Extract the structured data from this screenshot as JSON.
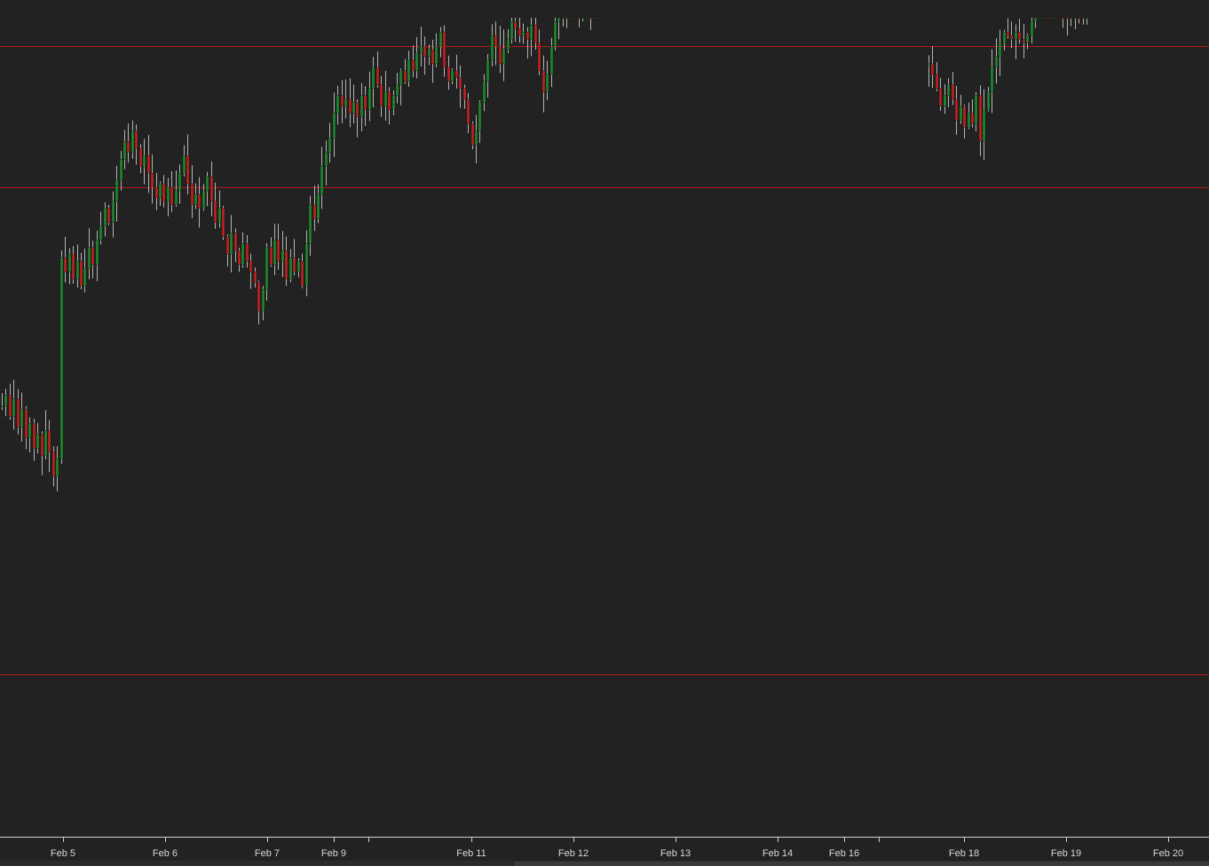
{
  "chart_data": {
    "type": "candlestick",
    "title": "",
    "xlabel": "",
    "ylabel": "",
    "x_tick_labels": [
      "Feb 5",
      "Feb 6",
      "Feb 7",
      "Feb 9",
      "",
      "Feb 11",
      "Feb 12",
      "Feb 13",
      "Feb 14",
      "Feb 16",
      "",
      "Feb 18",
      "Feb 19",
      "Feb 20"
    ],
    "horizontal_levels": [
      92.0,
      88.0,
      74.2
    ],
    "ylim": [
      69.6,
      93.2
    ],
    "grid": false,
    "colors": {
      "up": "#1e8a2e",
      "down": "#c32222",
      "wick": "#b5b5b5",
      "level_line": "#b31b1b",
      "background": "#222222",
      "axis": "#cfcfcf"
    },
    "series": [
      {
        "segment": 1,
        "closes": [
          81.8,
          82.1,
          81.5,
          82.0,
          81.2,
          81.7,
          80.9,
          81.3,
          80.6,
          81.0,
          80.4,
          81.1,
          80.5,
          79.8,
          80.3,
          86.0,
          85.6,
          86.1,
          85.4,
          85.9,
          85.2,
          85.7,
          86.3,
          85.8,
          86.5,
          86.9,
          87.4,
          87.0,
          87.6,
          88.2,
          88.8,
          89.3,
          89.0,
          89.6,
          89.1,
          88.6,
          88.9,
          88.4,
          88.0,
          87.7,
          88.1,
          87.6,
          88.0,
          87.5,
          87.9,
          88.4,
          88.9,
          88.1,
          87.5,
          87.8,
          87.4,
          87.9,
          88.3,
          87.6,
          87.0,
          87.4,
          86.6,
          86.1,
          86.7,
          86.2,
          85.8,
          86.4,
          85.9,
          85.6,
          85.3,
          84.5,
          85.1,
          86.3,
          85.8,
          86.5,
          85.9,
          86.2,
          85.4,
          86.0,
          85.6,
          85.9,
          85.2,
          86.4,
          87.5,
          87.1,
          87.8,
          88.6,
          89.0,
          89.4,
          90.1,
          90.6,
          90.3,
          90.5,
          90.1,
          90.4,
          90.0,
          90.6,
          90.2,
          90.8,
          91.4,
          90.9,
          90.3,
          90.7,
          90.2,
          90.6,
          90.9,
          91.3,
          91.0,
          91.6,
          91.3,
          91.8,
          92.0,
          91.7,
          91.9,
          91.5,
          92.0,
          92.4,
          91.4,
          91.0,
          91.3,
          91.1,
          90.8,
          90.5,
          89.8,
          89.2,
          89.6,
          90.4,
          91.0,
          91.6,
          92.3,
          92.0,
          91.5,
          91.9,
          92.2,
          92.7,
          92.5,
          92.3,
          92.4,
          92.2,
          92.6,
          92.1,
          91.3,
          90.7,
          91.2,
          92.0,
          92.7,
          93.0,
          92.9,
          93.2,
          93.1,
          93.2,
          93.0,
          93.1,
          93.3,
          93.0,
          93.1,
          93.2
        ]
      },
      {
        "segment": 2,
        "closes": [
          91.5,
          91.2,
          90.8,
          90.3,
          90.6,
          90.9,
          90.5,
          89.9,
          90.3,
          89.7,
          90.1,
          89.8,
          90.6,
          89.3,
          90.2,
          90.7,
          91.4,
          91.7,
          92.1,
          92.4,
          92.3,
          92.2,
          92.4,
          92.2,
          92.1,
          92.3,
          92.7,
          93.3,
          93.6,
          93.8,
          93.4,
          93.9,
          94.2,
          93.4,
          92.8,
          93.5,
          92.9,
          93.3,
          93.1,
          92.8,
          93.4
        ]
      }
    ]
  }
}
